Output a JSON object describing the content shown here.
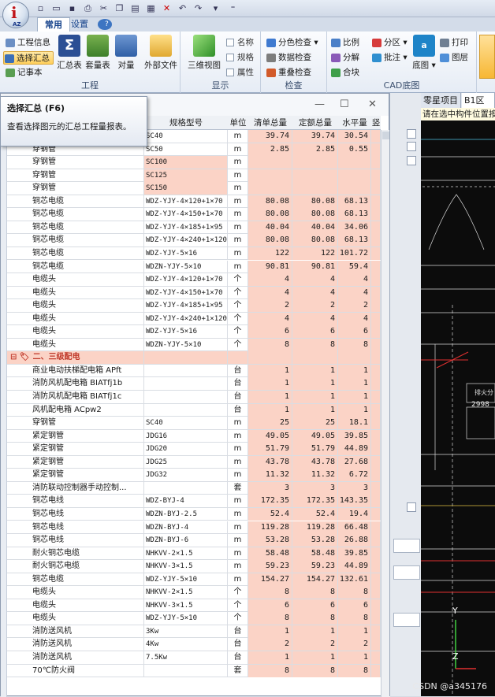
{
  "qat": {
    "more": "⁼"
  },
  "tabs": {
    "common": "常用",
    "settings": "设置"
  },
  "ribbon": {
    "project": {
      "info": "工程信息",
      "select_summary": "选择汇总",
      "notepad": "记事本",
      "summary_table": "汇总表",
      "set_table": "套量表",
      "compare": "对量",
      "external_file": "外部文件",
      "label": "工程"
    },
    "display": {
      "view3d": "三维视图",
      "name": "名称",
      "spec": "规格",
      "attr": "属性",
      "label": "显示"
    },
    "check": {
      "color_check": "分色检查",
      "data_check": "数据检查",
      "overlap_check": "重叠检查",
      "label": "检查"
    },
    "cad": {
      "scale": "比例",
      "zone": "分区",
      "decompose": "分解",
      "annotate": "批注",
      "merge": "合块",
      "drawing": "底图",
      "print": "打印",
      "layer": "图层",
      "label": "CAD底图"
    }
  },
  "tooltip": {
    "title": "选择汇总 (F6)",
    "desc": "查看选择图元的汇总工程量报表。"
  },
  "table": {
    "headers": {
      "spec": "规格型号",
      "unit": "单位",
      "list_total": "清单总量",
      "quota_total": "定额总量",
      "horizontal": "水平量",
      "extra": "竖"
    },
    "rows": [
      {
        "name": "",
        "spec": "SC40",
        "unit": "m",
        "list": "39.74",
        "quota": "39.74",
        "h": "30.54",
        "hl": false
      },
      {
        "name": "穿钢管",
        "spec": "SC50",
        "unit": "m",
        "list": "2.85",
        "quota": "2.85",
        "h": "0.55",
        "hl": false
      },
      {
        "name": "穿钢管",
        "spec": "SC100",
        "unit": "m",
        "list": "",
        "quota": "",
        "h": "",
        "hl": true
      },
      {
        "name": "穿钢管",
        "spec": "SC125",
        "unit": "m",
        "list": "",
        "quota": "",
        "h": "",
        "hl": true
      },
      {
        "name": "穿钢管",
        "spec": "SC150",
        "unit": "m",
        "list": "",
        "quota": "",
        "h": "",
        "hl": true
      },
      {
        "name": "铜芯电缆",
        "spec": "WDZ-YJY-4×120+1×70",
        "unit": "m",
        "list": "80.08",
        "quota": "80.08",
        "h": "68.13",
        "hl": false
      },
      {
        "name": "铜芯电缆",
        "spec": "WDZ-YJY-4×150+1×70",
        "unit": "m",
        "list": "80.08",
        "quota": "80.08",
        "h": "68.13",
        "hl": false
      },
      {
        "name": "铜芯电缆",
        "spec": "WDZ-YJY-4×185+1×95",
        "unit": "m",
        "list": "40.04",
        "quota": "40.04",
        "h": "34.06",
        "hl": false
      },
      {
        "name": "铜芯电缆",
        "spec": "WDZ-YJY-4×240+1×120",
        "unit": "m",
        "list": "80.08",
        "quota": "80.08",
        "h": "68.13",
        "hl": false
      },
      {
        "name": "铜芯电缆",
        "spec": "WDZ-YJY-5×16",
        "unit": "m",
        "list": "122",
        "quota": "122",
        "h": "101.72",
        "hl": false
      },
      {
        "name": "铜芯电缆",
        "spec": "WDZN-YJY-5×10",
        "unit": "m",
        "list": "90.81",
        "quota": "90.81",
        "h": "59.4",
        "hl": false
      },
      {
        "name": "电缆头",
        "spec": "WDZ-YJY-4×120+1×70",
        "unit": "个",
        "list": "4",
        "quota": "4",
        "h": "4",
        "hl": false
      },
      {
        "name": "电缆头",
        "spec": "WDZ-YJY-4×150+1×70",
        "unit": "个",
        "list": "4",
        "quota": "4",
        "h": "4",
        "hl": false
      },
      {
        "name": "电缆头",
        "spec": "WDZ-YJY-4×185+1×95",
        "unit": "个",
        "list": "2",
        "quota": "2",
        "h": "2",
        "hl": false
      },
      {
        "name": "电缆头",
        "spec": "WDZ-YJY-4×240+1×120",
        "unit": "个",
        "list": "4",
        "quota": "4",
        "h": "4",
        "hl": false
      },
      {
        "name": "电缆头",
        "spec": "WDZ-YJY-5×16",
        "unit": "个",
        "list": "6",
        "quota": "6",
        "h": "6",
        "hl": false
      },
      {
        "name": "电缆头",
        "spec": "WDZN-YJY-5×10",
        "unit": "个",
        "list": "8",
        "quota": "8",
        "h": "8",
        "hl": false
      },
      {
        "name": "二、三级配电",
        "spec": "",
        "unit": "",
        "list": "",
        "quota": "",
        "h": "",
        "hl": true,
        "group": true,
        "prefix": "⊟ 🏷"
      },
      {
        "name": "商业电动扶梯配电箱 APft",
        "spec": "",
        "unit": "台",
        "list": "1",
        "quota": "1",
        "h": "1",
        "hl": false
      },
      {
        "name": "消防风机配电箱 BIATfj1b",
        "spec": "",
        "unit": "台",
        "list": "1",
        "quota": "1",
        "h": "1",
        "hl": false
      },
      {
        "name": "消防风机配电箱 BIATfj1c",
        "spec": "",
        "unit": "台",
        "list": "1",
        "quota": "1",
        "h": "1",
        "hl": false
      },
      {
        "name": "风机配电箱 ACpw2",
        "spec": "",
        "unit": "台",
        "list": "1",
        "quota": "1",
        "h": "1",
        "hl": false
      },
      {
        "name": "穿钢管",
        "spec": "SC40",
        "unit": "m",
        "list": "25",
        "quota": "25",
        "h": "18.1",
        "hl": false
      },
      {
        "name": "紧定钢管",
        "spec": "JDG16",
        "unit": "m",
        "list": "49.05",
        "quota": "49.05",
        "h": "39.85",
        "hl": false
      },
      {
        "name": "紧定钢管",
        "spec": "JDG20",
        "unit": "m",
        "list": "51.79",
        "quota": "51.79",
        "h": "44.89",
        "hl": false
      },
      {
        "name": "紧定钢管",
        "spec": "JDG25",
        "unit": "m",
        "list": "43.78",
        "quota": "43.78",
        "h": "27.68",
        "hl": false
      },
      {
        "name": "紧定钢管",
        "spec": "JDG32",
        "unit": "m",
        "list": "11.32",
        "quota": "11.32",
        "h": "6.72",
        "hl": false
      },
      {
        "name": "消防联动控制器手动控制...",
        "spec": "",
        "unit": "套",
        "list": "3",
        "quota": "3",
        "h": "3",
        "hl": false
      },
      {
        "name": "铜芯电线",
        "spec": "WDZ-BYJ-4",
        "unit": "m",
        "list": "172.35",
        "quota": "172.35",
        "h": "143.35",
        "hl": false
      },
      {
        "name": "铜芯电线",
        "spec": "WDZN-BYJ-2.5",
        "unit": "m",
        "list": "52.4",
        "quota": "52.4",
        "h": "19.4",
        "hl": false
      },
      {
        "name": "铜芯电线",
        "spec": "WDZN-BYJ-4",
        "unit": "m",
        "list": "119.28",
        "quota": "119.28",
        "h": "66.48",
        "hl": false
      },
      {
        "name": "铜芯电线",
        "spec": "WDZN-BYJ-6",
        "unit": "m",
        "list": "53.28",
        "quota": "53.28",
        "h": "26.88",
        "hl": false
      },
      {
        "name": "耐火铜芯电缆",
        "spec": "NHKVV-2×1.5",
        "unit": "m",
        "list": "58.48",
        "quota": "58.48",
        "h": "39.85",
        "hl": false
      },
      {
        "name": "耐火铜芯电缆",
        "spec": "NHKVV-3×1.5",
        "unit": "m",
        "list": "59.23",
        "quota": "59.23",
        "h": "44.89",
        "hl": false
      },
      {
        "name": "铜芯电缆",
        "spec": "WDZ-YJY-5×10",
        "unit": "m",
        "list": "154.27",
        "quota": "154.27",
        "h": "132.61",
        "hl": false
      },
      {
        "name": "电缆头",
        "spec": "NHKVV-2×1.5",
        "unit": "个",
        "list": "8",
        "quota": "8",
        "h": "8",
        "hl": false
      },
      {
        "name": "电缆头",
        "spec": "NHKVV-3×1.5",
        "unit": "个",
        "list": "6",
        "quota": "6",
        "h": "6",
        "hl": false
      },
      {
        "name": "电缆头",
        "spec": "WDZ-YJY-5×10",
        "unit": "个",
        "list": "8",
        "quota": "8",
        "h": "8",
        "hl": false
      },
      {
        "name": "消防送风机",
        "spec": "3Kw",
        "unit": "台",
        "list": "1",
        "quota": "1",
        "h": "1",
        "hl": false
      },
      {
        "name": "消防送风机",
        "spec": "4Kw",
        "unit": "台",
        "list": "2",
        "quota": "2",
        "h": "2",
        "hl": false
      },
      {
        "name": "消防送风机",
        "spec": "7.5Kw",
        "unit": "台",
        "list": "1",
        "quota": "1",
        "h": "1",
        "hl": false
      },
      {
        "name": "70℃防火阀",
        "spec": "",
        "unit": "套",
        "list": "8",
        "quota": "8",
        "h": "8",
        "hl": false
      }
    ]
  },
  "cad": {
    "tab1": "零星项目",
    "tab2": "B1区地库",
    "hint": "请在选中构件位置按",
    "num1": "2998",
    "box": "排火分",
    "axis_y": "Y",
    "axis_z": "Z"
  },
  "watermark": "CSDN @a345176"
}
